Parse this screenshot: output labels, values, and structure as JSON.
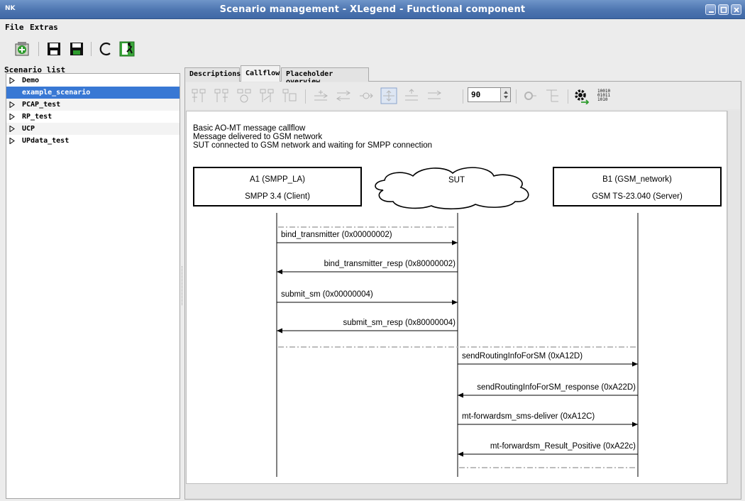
{
  "window": {
    "logo": "NK",
    "title": "Scenario management - XLegend - Functional component"
  },
  "menu": {
    "file": "File",
    "extras": "Extras"
  },
  "toolbar": {
    "icons": [
      "new-scenario-icon",
      "save-icon",
      "save-as-icon",
      "refresh-icon",
      "exit-icon"
    ]
  },
  "scenario_list": {
    "label": "Scenario list",
    "items": [
      {
        "label": "Demo",
        "expandable": true,
        "selected": false
      },
      {
        "label": "example_scenario",
        "expandable": false,
        "selected": true
      },
      {
        "label": "PCAP_test",
        "expandable": true,
        "selected": false
      },
      {
        "label": "RP_test",
        "expandable": true,
        "selected": false
      },
      {
        "label": "UCP",
        "expandable": true,
        "selected": false
      },
      {
        "label": "UPdata_test",
        "expandable": true,
        "selected": false
      }
    ]
  },
  "tabs": {
    "descriptions": "Descriptions",
    "callflow": "Callflow",
    "placeholder": "Placeholder overview",
    "active": "callflow"
  },
  "callflow_toolbar": {
    "zoom": "90"
  },
  "callflow": {
    "description": [
      "Basic AO-MT message callflow",
      "Message delivered to GSM network",
      "SUT connected to GSM network and waiting for SMPP connection"
    ],
    "entity_a": {
      "name": "A1 (SMPP_LA)",
      "protocol": "SMPP 3.4 (Client)"
    },
    "sut": {
      "name": "SUT"
    },
    "entity_b": {
      "name": "B1 (GSM_network)",
      "protocol": "GSM TS-23.040 (Server)"
    },
    "messages": [
      {
        "label": "bind_transmitter (0x00000002)",
        "from": "A1",
        "to": "SUT"
      },
      {
        "label": "bind_transmitter_resp (0x80000002)",
        "from": "SUT",
        "to": "A1"
      },
      {
        "label": "submit_sm (0x00000004)",
        "from": "A1",
        "to": "SUT"
      },
      {
        "label": "submit_sm_resp (0x80000004)",
        "from": "SUT",
        "to": "A1"
      },
      {
        "label": "sendRoutingInfoForSM (0xA12D)",
        "from": "SUT",
        "to": "B1"
      },
      {
        "label": "sendRoutingInfoForSM_response (0xA22D)",
        "from": "B1",
        "to": "SUT"
      },
      {
        "label": "mt-forwardsm_sms-deliver (0xA12C)",
        "from": "SUT",
        "to": "B1"
      },
      {
        "label": "mt-forwardsm_Result_Positive (0xA22c)",
        "from": "B1",
        "to": "SUT"
      }
    ]
  }
}
